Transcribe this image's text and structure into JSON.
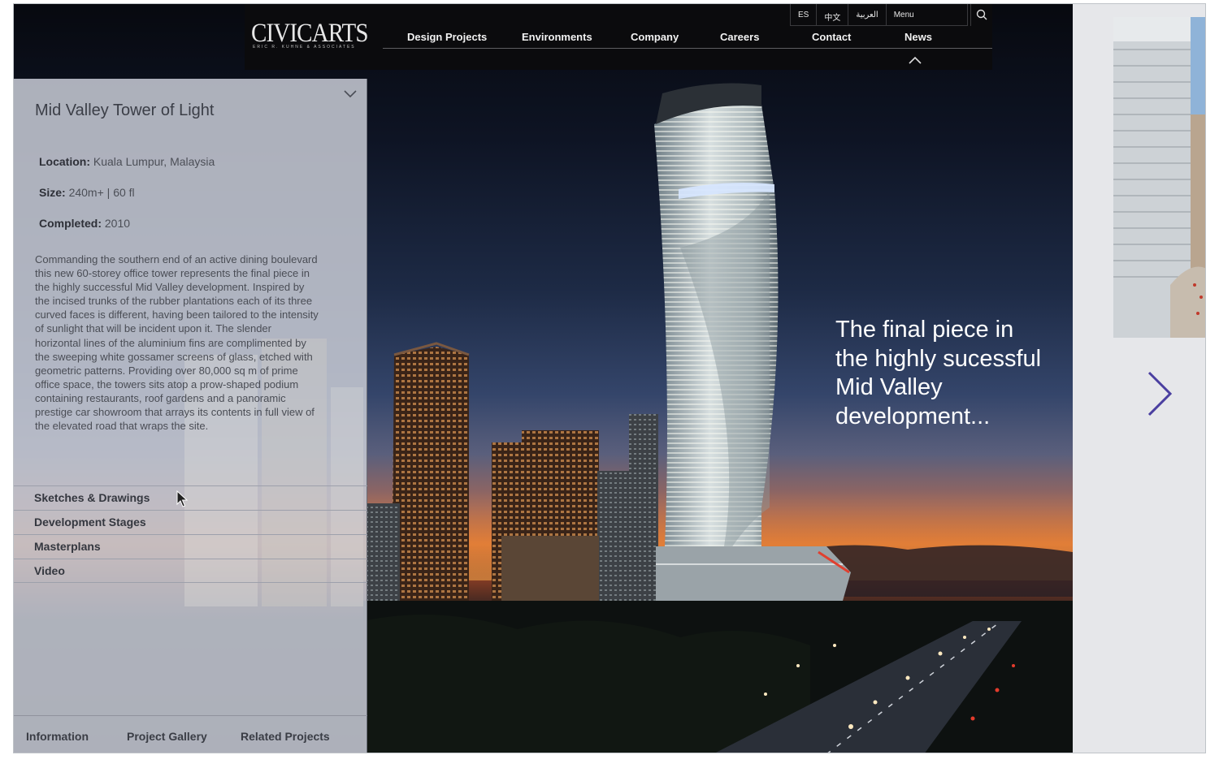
{
  "nav": {
    "logo": "CIVICARTS",
    "logo_sub": "ERIC R. KUHNE & ASSOCIATES",
    "languages": [
      "ES",
      "中文",
      "العربية"
    ],
    "menu_label": "Menu",
    "items": [
      "Design Projects",
      "Environments",
      "Company",
      "Careers",
      "Contact",
      "News"
    ]
  },
  "project": {
    "title": "Mid Valley Tower of Light",
    "location_label": "Location:",
    "location": "Kuala Lumpur, Malaysia",
    "size_label": "Size:",
    "size": "240m+ | 60 fl",
    "completed_label": "Completed:",
    "completed": "2010",
    "description": "Commanding the southern end of an active dining boulevard this new 60-storey office tower represents the final piece in the highly successful Mid Valley development. Inspired by the incised trunks of the rubber plantations each of its three curved faces is different, having been tailored to the intensity of sunlight that will be incident upon it. The slender horizontal lines of the aluminium fins are complimented by the sweeping white gossamer screens of glass, etched with geometric patterns. Providing over 80,000 sq m of prime office space, the towers sits atop a prow-shaped podium containing restaurants, roof gardens and a panoramic prestige car showroom that arrays its contents in full view of the elevated road that wraps the site.",
    "sublinks": [
      "Sketches & Drawings",
      "Development Stages",
      "Masterplans",
      "Video"
    ],
    "tabs": [
      "Information",
      "Project Gallery",
      "Related Projects"
    ]
  },
  "hero": {
    "caption": "The final piece in the highly sucessful Mid Valley development..."
  },
  "colors": {
    "nav_bg": "#0b0b0d",
    "panel_bg": "#c4c7d2",
    "rail_bg": "#e6e7ea",
    "arrow": "#4a3fa0"
  },
  "icons": {
    "search": "search-icon",
    "collapse": "chevron-up-icon",
    "panel_toggle": "chevron-down-icon",
    "next": "chevron-right-icon",
    "cursor": "mouse-pointer-icon"
  }
}
